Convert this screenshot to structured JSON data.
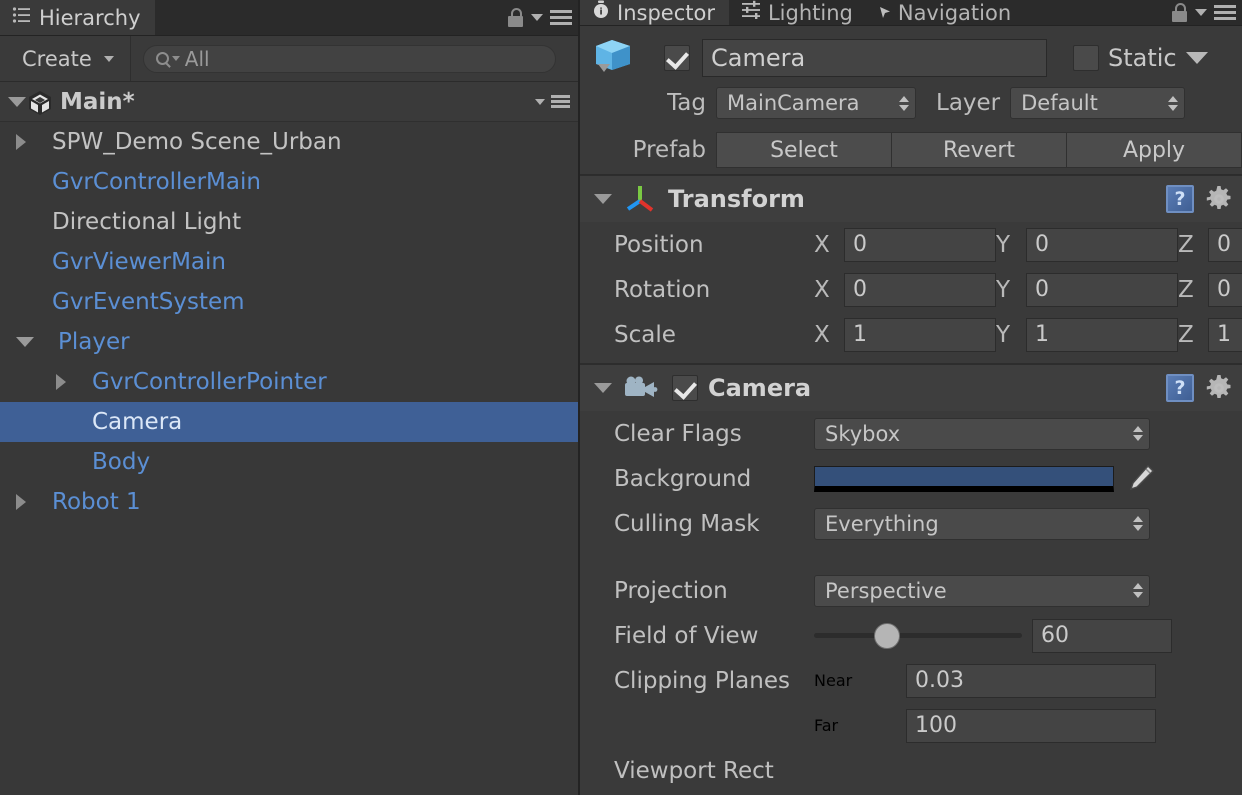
{
  "hierarchy": {
    "tab": {
      "label": "Hierarchy",
      "icon": "hierarchy-list-icon"
    },
    "toolbar": {
      "create_label": "Create",
      "create_caret": "chevron-down-icon",
      "search_value": "All",
      "search_icon": "search-icon"
    },
    "scene": {
      "name": "Main*",
      "icon": "unity-logo-icon",
      "expanded": true
    },
    "nodes": [
      {
        "label": "SPW_Demo Scene_Urban",
        "depth": 1,
        "arrow": "closed",
        "prefab": false,
        "selected": false
      },
      {
        "label": "GvrControllerMain",
        "depth": 1,
        "arrow": "none",
        "prefab": true,
        "selected": false
      },
      {
        "label": "Directional Light",
        "depth": 1,
        "arrow": "none",
        "prefab": false,
        "selected": false
      },
      {
        "label": "GvrViewerMain",
        "depth": 1,
        "arrow": "none",
        "prefab": true,
        "selected": false
      },
      {
        "label": "GvrEventSystem",
        "depth": 1,
        "arrow": "none",
        "prefab": true,
        "selected": false
      },
      {
        "label": "Player",
        "depth": 1,
        "arrow": "open",
        "prefab": true,
        "selected": false
      },
      {
        "label": "GvrControllerPointer",
        "depth": 2,
        "arrow": "closed",
        "prefab": true,
        "selected": false
      },
      {
        "label": "Camera",
        "depth": 2,
        "arrow": "none",
        "prefab": true,
        "selected": true
      },
      {
        "label": "Body",
        "depth": 2,
        "arrow": "none",
        "prefab": true,
        "selected": false
      },
      {
        "label": "Robot 1",
        "depth": 1,
        "arrow": "closed",
        "prefab": true,
        "selected": false
      }
    ]
  },
  "inspector": {
    "tabs": [
      {
        "label": "Inspector",
        "icon": "inspector-icon",
        "active": true
      },
      {
        "label": "Lighting",
        "icon": "lighting-icon",
        "active": false
      },
      {
        "label": "Navigation",
        "icon": "navigation-icon",
        "active": false
      }
    ],
    "gameobject": {
      "icon": "gameobject-cube-icon",
      "enabled": true,
      "name": "Camera",
      "static_label": "Static",
      "static_checked": false,
      "tag_label": "Tag",
      "tag_value": "MainCamera",
      "layer_label": "Layer",
      "layer_value": "Default",
      "prefab_label": "Prefab",
      "prefab_buttons": [
        "Select",
        "Revert",
        "Apply"
      ]
    },
    "components": [
      {
        "name": "Transform",
        "icon": "transform-axis-icon",
        "expanded": true,
        "has_checkbox": false,
        "rows": [
          {
            "type": "vector3",
            "label": "Position",
            "axes": [
              "X",
              "Y",
              "Z"
            ],
            "values": [
              "0",
              "0",
              "0"
            ]
          },
          {
            "type": "vector3",
            "label": "Rotation",
            "axes": [
              "X",
              "Y",
              "Z"
            ],
            "values": [
              "0",
              "0",
              "0"
            ]
          },
          {
            "type": "vector3",
            "label": "Scale",
            "axes": [
              "X",
              "Y",
              "Z"
            ],
            "values": [
              "1",
              "1",
              "1"
            ]
          }
        ]
      },
      {
        "name": "Camera",
        "icon": "camera-icon",
        "expanded": true,
        "has_checkbox": true,
        "checked": true,
        "rows": [
          {
            "type": "dropdown",
            "label": "Clear Flags",
            "value": "Skybox"
          },
          {
            "type": "color",
            "label": "Background",
            "value": "#34507a"
          },
          {
            "type": "dropdown",
            "label": "Culling Mask",
            "value": "Everything"
          },
          {
            "type": "gap"
          },
          {
            "type": "dropdown",
            "label": "Projection",
            "value": "Perspective"
          },
          {
            "type": "slider",
            "label": "Field of View",
            "value": "60",
            "min": 1,
            "max": 179
          },
          {
            "type": "pair",
            "label": "Clipping Planes",
            "sub_label": "Near",
            "value": "0.03"
          },
          {
            "type": "pair",
            "label": "",
            "sub_label": "Far",
            "value": "100"
          },
          {
            "type": "label",
            "label": "Viewport Rect"
          }
        ]
      }
    ]
  },
  "icons": {
    "lock": "lock-open-icon",
    "menu": "hamburger-menu-icon",
    "gear": "gear-icon",
    "help": "help-book-icon",
    "eyedropper": "eyedropper-icon"
  },
  "colors": {
    "selection": "#3f6096",
    "prefab_blue": "#5b8fd4",
    "panel_bg": "#3a3a3a",
    "tabbar_bg": "#2b2b2b",
    "background_swatch": "#34507a"
  }
}
